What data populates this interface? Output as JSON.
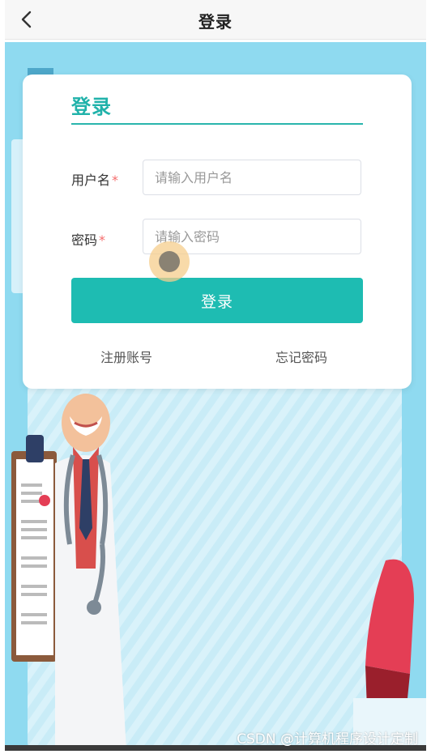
{
  "navbar": {
    "title": "登录",
    "back_icon": "chevron-left-icon"
  },
  "card": {
    "title": "登录",
    "accent_color": "#20b2aa",
    "username": {
      "label": "用户名",
      "required_mark": "*",
      "placeholder": "请输入用户名",
      "value": ""
    },
    "password": {
      "label": "密码",
      "required_mark": "*",
      "placeholder": "请输入密码",
      "value": ""
    },
    "login_button": "登录",
    "register_link": "注册账号",
    "forgot_link": "忘记密码"
  },
  "background": {
    "color": "#8fdaf0",
    "illustration": "doctor-with-clipboard-illustration"
  },
  "watermark": "CSDN @计算机程序设计定制"
}
